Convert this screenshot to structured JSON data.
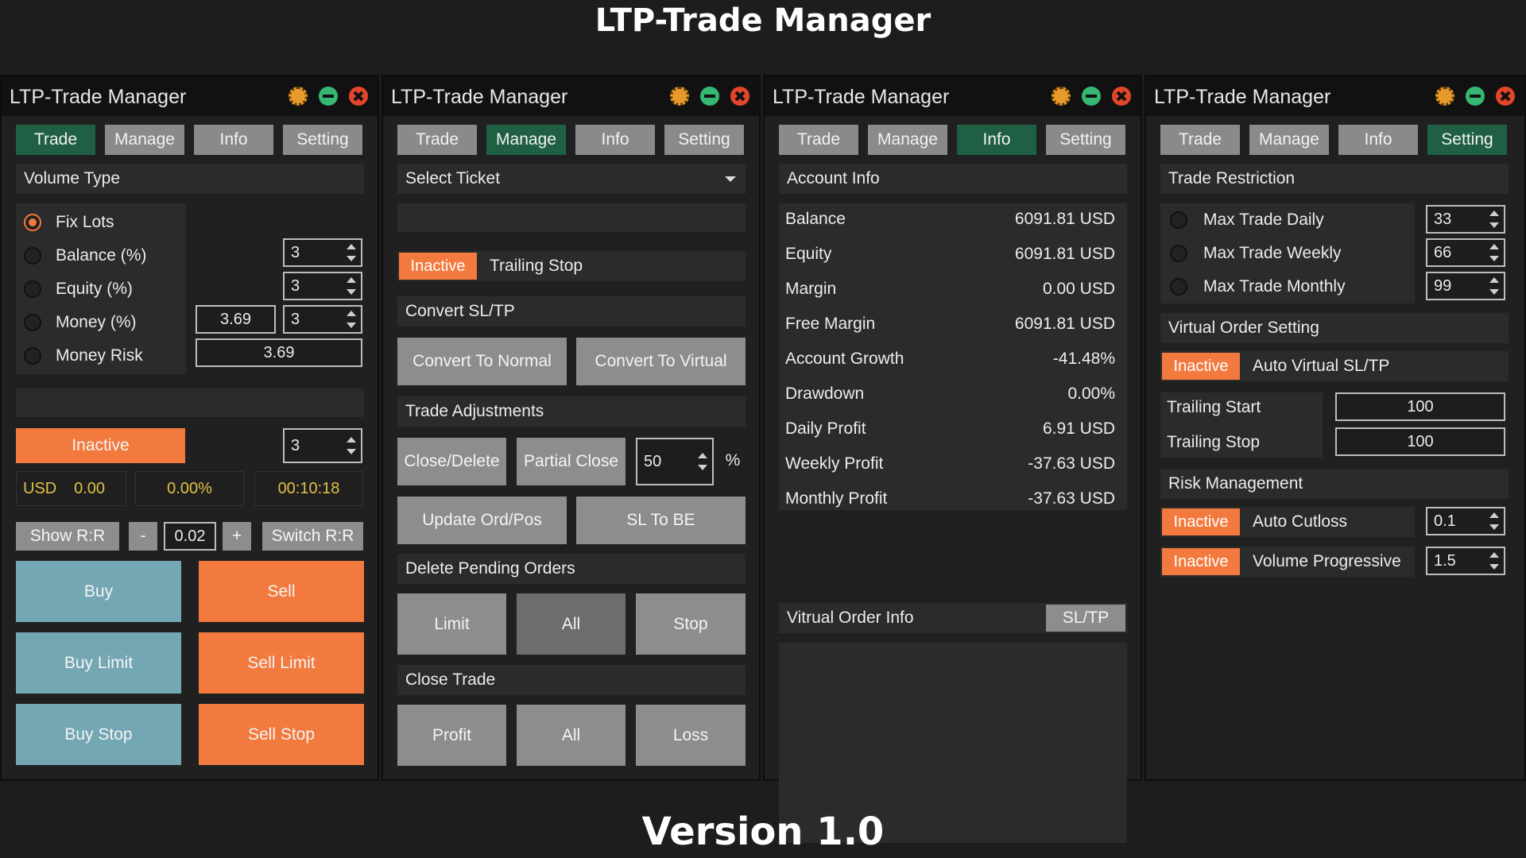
{
  "title": "LTP-Trade Manager",
  "footer": "Version 1.0",
  "colors": {
    "accent_orange": "#f37a3e",
    "accent_blue": "#74a7b4",
    "tab_active": "#1f5f44",
    "button_gray": "#8d8d8d"
  },
  "panel_title": "LTP-Trade Manager",
  "tabs": [
    "Trade",
    "Manage",
    "Info",
    "Setting"
  ],
  "trade": {
    "volume_type": "Volume Type",
    "options": [
      "Fix Lots",
      "Balance (%)",
      "Equity (%)",
      "Money (%)",
      "Money Risk"
    ],
    "selected_option": "Fix Lots",
    "balance_val": "3",
    "equity_val": "3",
    "money_field": "3.69",
    "money_val": "3",
    "money_risk_val": "3.69",
    "inactive": "Inactive",
    "inactive_val": "3",
    "currency": "USD",
    "amount": "0.00",
    "percent": "0.00%",
    "timer": "00:10:18",
    "show_rr": "Show R:R",
    "minus": "-",
    "lot_step": "0.02",
    "plus": "+",
    "switch_rr": "Switch R:R",
    "buy": "Buy",
    "sell": "Sell",
    "buy_limit": "Buy Limit",
    "sell_limit": "Sell Limit",
    "buy_stop": "Buy Stop",
    "sell_stop": "Sell Stop"
  },
  "manage": {
    "select_ticket": "Select Ticket",
    "inactive": "Inactive",
    "trailing_stop": "Trailing Stop",
    "convert_sltp": "Convert SL/TP",
    "convert_normal": "Convert To Normal",
    "convert_virtual": "Convert To Virtual",
    "trade_adjustments": "Trade Adjustments",
    "close_delete": "Close/Delete",
    "partial_close": "Partial Close",
    "partial_val": "50",
    "percent_sign": "%",
    "update_ord_pos": "Update Ord/Pos",
    "sl_to_be": "SL To BE",
    "delete_pending": "Delete Pending Orders",
    "limit": "Limit",
    "all": "All",
    "stop": "Stop",
    "close_trade": "Close Trade",
    "profit": "Profit",
    "loss": "Loss"
  },
  "info": {
    "account_info": "Account Info",
    "rows": [
      {
        "label": "Balance",
        "value": "6091.81 USD"
      },
      {
        "label": "Equity",
        "value": "6091.81 USD"
      },
      {
        "label": "Margin",
        "value": "0.00 USD"
      },
      {
        "label": "Free Margin",
        "value": "6091.81 USD"
      },
      {
        "label": "Account Growth",
        "value": "-41.48%"
      },
      {
        "label": "Drawdown",
        "value": "0.00%"
      },
      {
        "label": "Daily Profit",
        "value": "6.91 USD"
      },
      {
        "label": "Weekly Profit",
        "value": "-37.63 USD"
      },
      {
        "label": "Monthly Profit",
        "value": "-37.63 USD"
      }
    ],
    "virtual_order_info": "Vitrual Order Info",
    "sltp": "SL/TP"
  },
  "setting": {
    "trade_restriction": "Trade Restriction",
    "max_daily": "Max Trade Daily",
    "max_daily_val": "33",
    "max_weekly": "Max Trade Weekly",
    "max_weekly_val": "66",
    "max_monthly": "Max Trade Monthly",
    "max_monthly_val": "99",
    "virtual_order_setting": "Virtual Order Setting",
    "inactive": "Inactive",
    "auto_virtual": "Auto Virtual SL/TP",
    "trailing_start": "Trailing Start",
    "trailing_start_val": "100",
    "trailing_stop": "Trailing Stop",
    "trailing_stop_val": "100",
    "risk_management": "Risk Management",
    "auto_cutloss": "Auto Cutloss",
    "auto_cutloss_val": "0.1",
    "volume_progressive": "Volume Progressive",
    "volume_progressive_val": "1.5"
  }
}
